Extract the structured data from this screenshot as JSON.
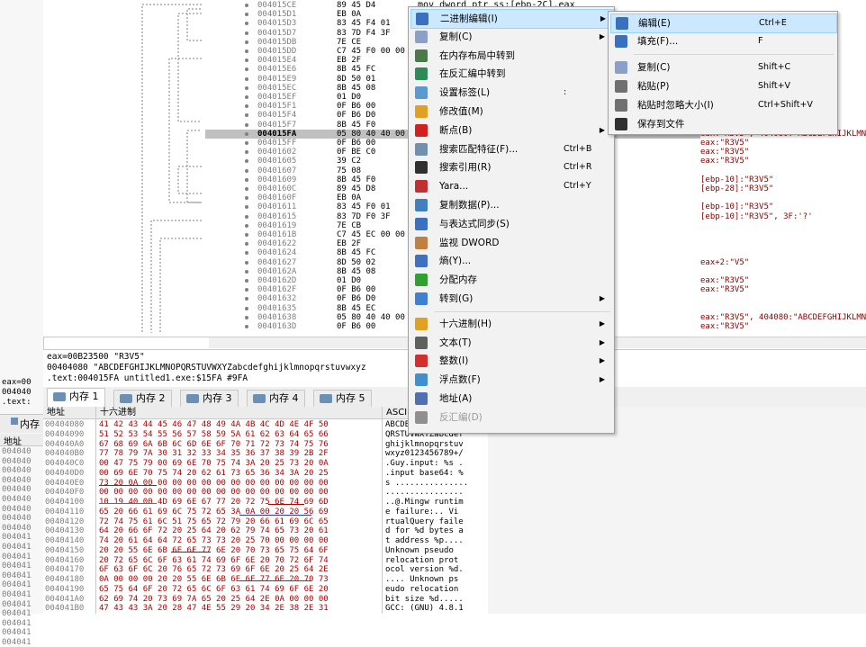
{
  "disasm": {
    "top_text": "mov dword ptr ss:[ebp-2C],eax",
    "rows": [
      {
        "addr": "004015CE",
        "bytes": "89 45 D4",
        "cur": false
      },
      {
        "addr": "004015D1",
        "bytes": "EB 0A",
        "cur": false,
        "jmp": true
      },
      {
        "addr": "004015D3",
        "bytes": "83 45 F4 01",
        "cur": false
      },
      {
        "addr": "004015D7",
        "bytes": "83 7D F4 3F",
        "cur": false
      },
      {
        "addr": "004015DB",
        "bytes": "7E CE",
        "cur": false,
        "jmp": true
      },
      {
        "addr": "004015DD",
        "bytes": "C7 45 F0 00 00 00 00",
        "cur": false
      },
      {
        "addr": "004015E4",
        "bytes": "EB 2F",
        "cur": false,
        "jmp": true
      },
      {
        "addr": "004015E6",
        "bytes": "8B 45 FC",
        "cur": false
      },
      {
        "addr": "004015E9",
        "bytes": "8D 50 01",
        "cur": false
      },
      {
        "addr": "004015EC",
        "bytes": "8B 45 08",
        "cur": false
      },
      {
        "addr": "004015EF",
        "bytes": "01 D0",
        "cur": false
      },
      {
        "addr": "004015F1",
        "bytes": "0F B6 00",
        "cur": false
      },
      {
        "addr": "004015F4",
        "bytes": "0F B6 D0",
        "cur": false
      },
      {
        "addr": "004015F7",
        "bytes": "8B 45 F0",
        "cur": false
      },
      {
        "addr": "004015FA",
        "bytes": "05 80 40 40 00",
        "cur": true
      },
      {
        "addr": "004015FF",
        "bytes": "0F B6 00",
        "cur": false
      },
      {
        "addr": "00401602",
        "bytes": "0F BE C0",
        "cur": false
      },
      {
        "addr": "00401605",
        "bytes": "39 C2",
        "cur": false
      },
      {
        "addr": "00401607",
        "bytes": "75 08",
        "cur": false,
        "jmp": true
      },
      {
        "addr": "00401609",
        "bytes": "8B 45 F0",
        "cur": false
      },
      {
        "addr": "0040160C",
        "bytes": "89 45 D8",
        "cur": false
      },
      {
        "addr": "0040160F",
        "bytes": "EB 0A",
        "cur": false,
        "jmp": true
      },
      {
        "addr": "00401611",
        "bytes": "83 45 F0 01",
        "cur": false
      },
      {
        "addr": "00401615",
        "bytes": "83 7D F0 3F",
        "cur": false
      },
      {
        "addr": "00401619",
        "bytes": "7E CB",
        "cur": false,
        "jmp": true
      },
      {
        "addr": "0040161B",
        "bytes": "C7 45 EC 00 00 00 00",
        "cur": false
      },
      {
        "addr": "00401622",
        "bytes": "EB 2F",
        "cur": false,
        "jmp": true
      },
      {
        "addr": "00401624",
        "bytes": "8B 45 FC",
        "cur": false
      },
      {
        "addr": "00401627",
        "bytes": "8D 50 02",
        "cur": false
      },
      {
        "addr": "0040162A",
        "bytes": "8B 45 08",
        "cur": false
      },
      {
        "addr": "0040162D",
        "bytes": "01 D0",
        "cur": false
      },
      {
        "addr": "0040162F",
        "bytes": "0F B6 00",
        "cur": false
      },
      {
        "addr": "00401632",
        "bytes": "0F B6 D0",
        "cur": false
      },
      {
        "addr": "00401635",
        "bytes": "8B 45 EC",
        "cur": false
      },
      {
        "addr": "00401638",
        "bytes": "05 80 40 40 00",
        "cur": false
      },
      {
        "addr": "0040163D",
        "bytes": "0F B6 00",
        "cur": false
      }
    ],
    "comments": [
      {
        "text": "eax:\"R3V5\", 404080:\"ABCDEFGHIJKLMNO",
        "row": 14
      },
      {
        "text": "eax:\"R3V5\"",
        "row": 15
      },
      {
        "text": "eax:\"R3V5\"",
        "row": 16
      },
      {
        "text": "eax:\"R3V5\"",
        "row": 17
      },
      {
        "text": "[ebp-10]:\"R3V5\"",
        "row": 19
      },
      {
        "text": "[ebp-28]:\"R3V5\"",
        "row": 20
      },
      {
        "text": "[ebp-10]:\"R3V5\"",
        "row": 22
      },
      {
        "text": "[ebp-10]:\"R3V5\", 3F:'?'",
        "row": 23
      },
      {
        "text": "eax+2:\"V5\"",
        "row": 28
      },
      {
        "text": "eax:\"R3V5\"",
        "row": 30
      },
      {
        "text": "eax:\"R3V5\"",
        "row": 31
      },
      {
        "text": "eax:\"R3V5\", 404080:\"ABCDEFGHIJKLMNO",
        "row": 34
      },
      {
        "text": "eax:\"R3V5\"",
        "row": 35
      }
    ]
  },
  "left_panel": {
    "lines_top": [
      "eax=00",
      "004040",
      ".text:"
    ],
    "tab_label": "内存",
    "header": "地址",
    "addrs": [
      "004040",
      "004040",
      "004040",
      "004040",
      "004040",
      "004040",
      "004040",
      "004040",
      "004040",
      "004041",
      "004041",
      "004041",
      "004041",
      "004041",
      "004041",
      "004041",
      "004041",
      "004041",
      "004041",
      "004041",
      "004041"
    ]
  },
  "info": {
    "line1": "eax=00B23500 \"R3V5\"",
    "line2": "00404080 \"ABCDEFGHIJKLMNOPQRSTUVWXYZabcdefghijklmnopqrstuvwxyz",
    "line3": ".text:004015FA untitled1.exe:$15FA #9FA"
  },
  "tabs": [
    "内存 1",
    "内存 2",
    "内存 3",
    "内存 4",
    "内存 5"
  ],
  "dump": {
    "col_addr": "地址",
    "col_hex": "十六进制",
    "col_ascii": "ASCII",
    "rows": [
      {
        "a": "00404080",
        "h": "41 42 43 44 45 46 47 48 49 4A 4B 4C 4D 4E 4F 50",
        "c": "ABCDEFGHIJKLMNOP"
      },
      {
        "a": "00404090",
        "h": "51 52 53 54 55 56 57 58 59 5A 61 62 63 64 65 66",
        "c": "QRSTUVWXYZabcdef"
      },
      {
        "a": "004040A0",
        "h": "67 68 69 6A 6B 6C 6D 6E 6F 70 71 72 73 74 75 76",
        "c": "ghijklmnopqrstuv"
      },
      {
        "a": "004040B0",
        "h": "77 78 79 7A 30 31 32 33 34 35 36 37 38 39 2B 2F",
        "c": "wxyz0123456789+/"
      },
      {
        "a": "004040C0",
        "h": "00 47 75 79 00 69 6E 70 75 74 3A 20 25 73 20 0A",
        "c": ".Guy.input: %s ."
      },
      {
        "a": "004040D0",
        "h": "00 69 6E 70 75 74 20 62 61 73 65 36 34 3A 20 25",
        "c": ".input base64: %"
      },
      {
        "a": "004040E0",
        "h": "73 20 0A 00 00 00 00 00 00 00 00 00 00 00 00 00",
        "c": "s ..............."
      },
      {
        "a": "004040F0",
        "h": "00 00 00 00 00 00 00 00 00 00 00 00 00 00 00 00",
        "c": "................"
      },
      {
        "a": "00404100",
        "h": "10 19 40 00 4D 69 6E 67 77 20 72 75 6E 74 69 6D",
        "c": "..@.Mingw runtim"
      },
      {
        "a": "00404110",
        "h": "65 20 66 61 69 6C 75 72 65 3A 0A 00 20 20 56 69",
        "c": "e failure:..  Vi"
      },
      {
        "a": "00404120",
        "h": "72 74 75 61 6C 51 75 65 72 79 20 66 61 69 6C 65",
        "c": "rtualQuery faile"
      },
      {
        "a": "00404130",
        "h": "64 20 66 6F 72 20 25 64 20 62 79 74 65 73 20 61",
        "c": "d for %d bytes a"
      },
      {
        "a": "00404140",
        "h": "74 20 61 64 64 72 65 73 73 20 25 70 00 00 00 00",
        "c": "t address %p...."
      },
      {
        "a": "00404150",
        "h": "20 20 55 6E 6B 6E 6F 77 6E 20 70 73 65 75 64 6F",
        "c": "  Unknown pseudo"
      },
      {
        "a": "00404160",
        "h": "20 72 65 6C 6F 63 61 74 69 6F 6E 20 70 72 6F 74",
        "c": " relocation prot"
      },
      {
        "a": "00404170",
        "h": "6F 63 6F 6C 20 76 65 72 73 69 6F 6E 20 25 64 2E",
        "c": "ocol version %d."
      },
      {
        "a": "00404180",
        "h": "0A 00 00 00 20 20 55 6E 6B 6E 6F 77 6E 20 70 73",
        "c": "....  Unknown ps"
      },
      {
        "a": "00404190",
        "h": "65 75 64 6F 20 72 65 6C 6F 63 61 74 69 6F 6E 20",
        "c": "eudo relocation "
      },
      {
        "a": "004041A0",
        "h": "62 69 74 20 73 69 7A 65 20 25 64 2E 0A 00 00 00",
        "c": "bit size %d....."
      },
      {
        "a": "004041B0",
        "h": "47 43 43 3A 20 28 47 4E 55 29 20 34 2E 38 2E 31",
        "c": "GCC: (GNU) 4.8.1"
      }
    ]
  },
  "context_menu": {
    "items": [
      {
        "label": "二进制编辑(I)",
        "shortcut": "",
        "arrow": true,
        "hl": true,
        "dis": false,
        "icon": "binary-edit-icon",
        "color": "#3a70c0"
      },
      {
        "label": "复制(C)",
        "shortcut": "",
        "arrow": true,
        "hl": false,
        "dis": false,
        "icon": "copy-icon",
        "color": "#8aa0c8"
      },
      {
        "label": "在内存布局中转到",
        "shortcut": "",
        "arrow": false,
        "hl": false,
        "dis": false,
        "icon": "memory-map-icon",
        "color": "#4a7a4a"
      },
      {
        "label": "在反汇编中转到",
        "shortcut": "",
        "arrow": false,
        "hl": false,
        "dis": false,
        "icon": "disassembly-icon",
        "color": "#2e8b57"
      },
      {
        "label": "设置标签(L)",
        "shortcut": ":",
        "arrow": false,
        "hl": false,
        "dis": false,
        "icon": "label-icon",
        "color": "#5a9ad0"
      },
      {
        "label": "修改值(M)",
        "shortcut": "",
        "arrow": false,
        "hl": false,
        "dis": false,
        "icon": "pencil-icon",
        "color": "#e0a020"
      },
      {
        "label": "断点(B)",
        "shortcut": "",
        "arrow": true,
        "hl": false,
        "dis": false,
        "icon": "breakpoint-icon",
        "color": "#d02020"
      },
      {
        "label": "搜索匹配特征(F)...",
        "shortcut": "Ctrl+B",
        "arrow": false,
        "hl": false,
        "dis": false,
        "icon": "search-pattern-icon",
        "color": "#7090b0"
      },
      {
        "label": "搜索引用(R)",
        "shortcut": "Ctrl+R",
        "arrow": false,
        "hl": false,
        "dis": false,
        "icon": "binoculars-icon",
        "color": "#303030"
      },
      {
        "label": "Yara...",
        "shortcut": "Ctrl+Y",
        "arrow": false,
        "hl": false,
        "dis": false,
        "icon": "yara-icon",
        "color": "#c03030"
      },
      {
        "label": "复制数据(P)...",
        "shortcut": "",
        "arrow": false,
        "hl": false,
        "dis": false,
        "icon": "copy-data-icon",
        "color": "#4080c0"
      },
      {
        "label": "与表达式同步(S)",
        "shortcut": "",
        "arrow": false,
        "hl": false,
        "dis": false,
        "icon": "sync-icon",
        "color": "#3a70c0"
      },
      {
        "label": "监视 DWORD",
        "shortcut": "",
        "arrow": false,
        "hl": false,
        "dis": false,
        "icon": "watch-icon",
        "color": "#c08040"
      },
      {
        "label": "熵(Y)...",
        "shortcut": "",
        "arrow": false,
        "hl": false,
        "dis": false,
        "icon": "entropy-icon",
        "color": "#4070c0"
      },
      {
        "label": "分配内存",
        "shortcut": "",
        "arrow": false,
        "hl": false,
        "dis": false,
        "icon": "allocate-icon",
        "color": "#30a030"
      },
      {
        "label": "转到(G)",
        "shortcut": "",
        "arrow": true,
        "hl": false,
        "dis": false,
        "icon": "goto-icon",
        "color": "#4080d0"
      },
      {
        "label": "十六进制(H)",
        "shortcut": "",
        "arrow": true,
        "hl": false,
        "dis": false,
        "icon": "hex-icon",
        "color": "#e0a020"
      },
      {
        "label": "文本(T)",
        "shortcut": "",
        "arrow": true,
        "hl": false,
        "dis": false,
        "icon": "text-icon",
        "color": "#606060"
      },
      {
        "label": "整数(I)",
        "shortcut": "",
        "arrow": true,
        "hl": false,
        "dis": false,
        "icon": "integer-icon",
        "color": "#d03030"
      },
      {
        "label": "浮点数(F)",
        "shortcut": "",
        "arrow": true,
        "hl": false,
        "dis": false,
        "icon": "float-icon",
        "color": "#4090d0"
      },
      {
        "label": "地址(A)",
        "shortcut": "",
        "arrow": false,
        "hl": false,
        "dis": false,
        "icon": "address-icon",
        "color": "#5070b0"
      },
      {
        "label": "反汇编(D)",
        "shortcut": "",
        "arrow": false,
        "hl": false,
        "dis": true,
        "icon": "disasm-view-icon",
        "color": "#909090"
      }
    ]
  },
  "submenu": {
    "items": [
      {
        "label": "编辑(E)",
        "shortcut": "Ctrl+E",
        "hl": true,
        "icon": "edit-binary-icon",
        "color": "#3a70c0"
      },
      {
        "label": "填充(F)...",
        "shortcut": "F",
        "hl": false,
        "icon": "fill-icon",
        "color": "#3a70c0"
      },
      {
        "label": "复制(C)",
        "shortcut": "Shift+C",
        "hl": false,
        "icon": "copy-icon",
        "color": "#8aa0c8"
      },
      {
        "label": "粘贴(P)",
        "shortcut": "Shift+V",
        "hl": false,
        "icon": "paste-icon",
        "color": "#707070"
      },
      {
        "label": "粘贴时忽略大小(I)",
        "shortcut": "Ctrl+Shift+V",
        "hl": false,
        "icon": "paste-ignore-size-icon",
        "color": "#707070"
      },
      {
        "label": "保存到文件",
        "shortcut": "",
        "hl": false,
        "icon": "save-icon",
        "color": "#303030"
      }
    ]
  }
}
